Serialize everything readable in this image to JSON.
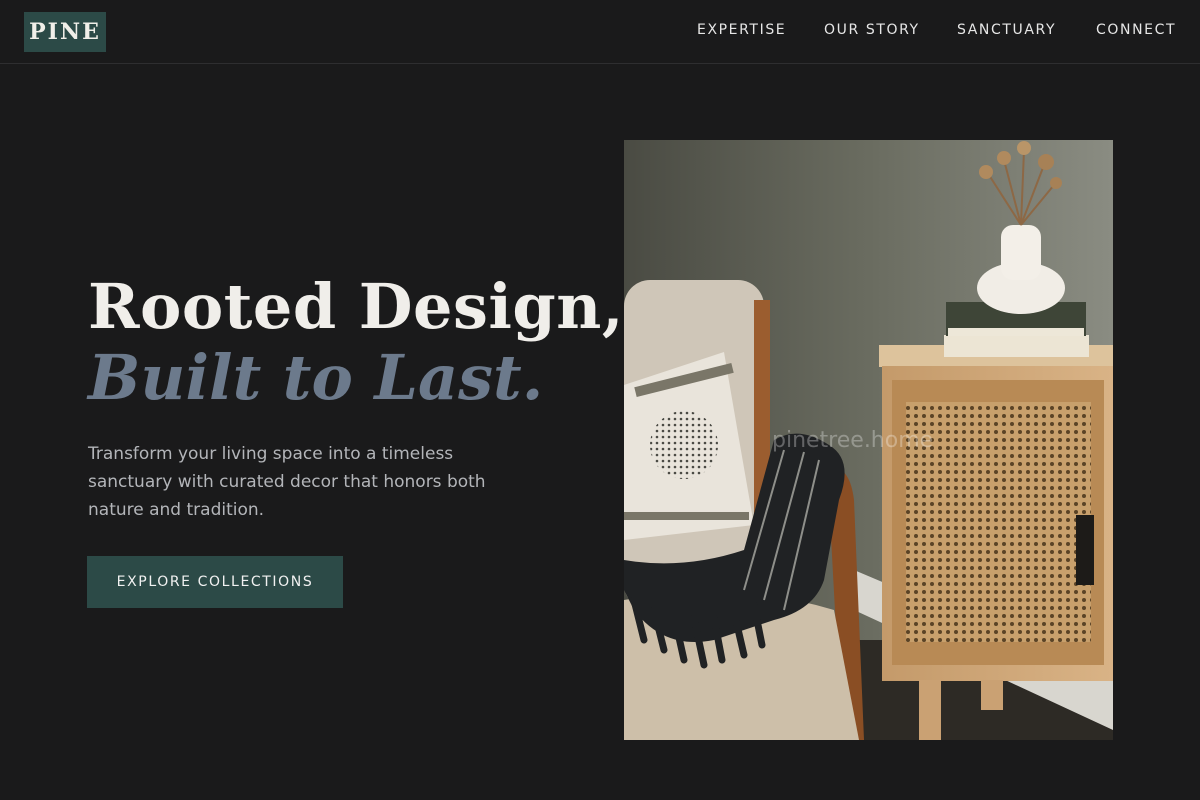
{
  "nav": {
    "logo": "PINE",
    "links": [
      "EXPERTISE",
      "OUR STORY",
      "SANCTUARY",
      "CONNECT"
    ]
  },
  "hero": {
    "title_line1": "Rooted Design,",
    "title_line2": "Built to Last.",
    "description": "Transform your living space into a timeless sanctuary with curated decor that honors both nature and tradition.",
    "cta_label": "EXPLORE COLLECTIONS"
  },
  "image": {
    "watermark": "pinetree.home"
  },
  "colors": {
    "background": "#1a1a1b",
    "accent": "#2c4a47",
    "headline_italic": "#6c7a8c",
    "body_text": "#b3b5b9"
  }
}
